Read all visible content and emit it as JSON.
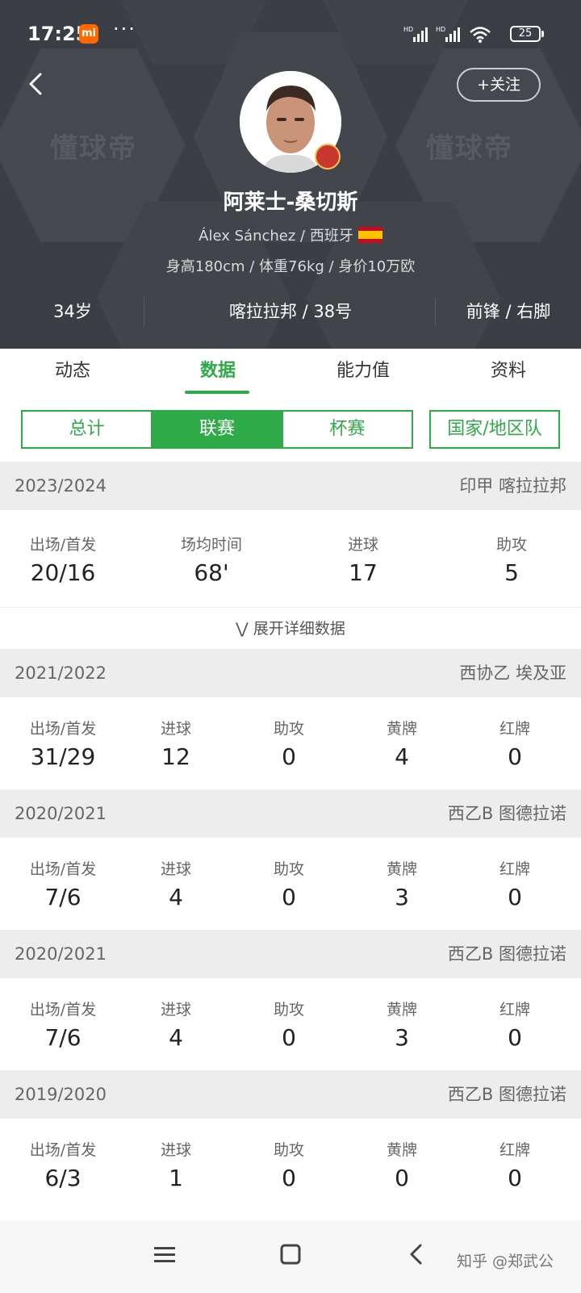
{
  "status_bar": {
    "time": "17:25",
    "mi_label": "mi",
    "dots": "···",
    "battery": "25"
  },
  "header": {
    "follow": "+关注",
    "watermark": "懂球帝",
    "name": "阿莱士-桑切斯",
    "sub_name": "Álex Sánchez / 西班牙",
    "body": "身高180cm / 体重76kg / 身价10万欧",
    "age": "34岁",
    "club_number": "喀拉拉邦 / 38号",
    "position_foot": "前锋 / 右脚"
  },
  "tabs": [
    {
      "label": "动态"
    },
    {
      "label": "数据"
    },
    {
      "label": "能力值"
    },
    {
      "label": "资料"
    }
  ],
  "filters": {
    "total": "总计",
    "league": "联赛",
    "cup": "杯赛",
    "national": "国家/地区队"
  },
  "expand_label": "展开详细数据",
  "seasons": [
    {
      "year": "2023/2024",
      "league": "印甲 喀拉拉邦",
      "stats": [
        {
          "label": "出场/首发",
          "value": "20/16"
        },
        {
          "label": "场均时间",
          "value": "68'"
        },
        {
          "label": "进球",
          "value": "17"
        },
        {
          "label": "助攻",
          "value": "5"
        }
      ]
    },
    {
      "year": "2021/2022",
      "league": "西协乙 埃及亚",
      "stats": [
        {
          "label": "出场/首发",
          "value": "31/29"
        },
        {
          "label": "进球",
          "value": "12"
        },
        {
          "label": "助攻",
          "value": "0"
        },
        {
          "label": "黄牌",
          "value": "4"
        },
        {
          "label": "红牌",
          "value": "0"
        }
      ]
    },
    {
      "year": "2020/2021",
      "league": "西乙B 图德拉诺",
      "stats": [
        {
          "label": "出场/首发",
          "value": "7/6"
        },
        {
          "label": "进球",
          "value": "4"
        },
        {
          "label": "助攻",
          "value": "0"
        },
        {
          "label": "黄牌",
          "value": "3"
        },
        {
          "label": "红牌",
          "value": "0"
        }
      ]
    },
    {
      "year": "2020/2021",
      "league": "西乙B 图德拉诺",
      "stats": [
        {
          "label": "出场/首发",
          "value": "7/6"
        },
        {
          "label": "进球",
          "value": "4"
        },
        {
          "label": "助攻",
          "value": "0"
        },
        {
          "label": "黄牌",
          "value": "3"
        },
        {
          "label": "红牌",
          "value": "0"
        }
      ]
    },
    {
      "year": "2019/2020",
      "league": "西乙B 图德拉诺",
      "stats": [
        {
          "label": "出场/首发",
          "value": "6/3"
        },
        {
          "label": "进球",
          "value": "1"
        },
        {
          "label": "助攻",
          "value": "0"
        },
        {
          "label": "黄牌",
          "value": "0"
        },
        {
          "label": "红牌",
          "value": "0"
        }
      ]
    }
  ],
  "footer_watermark": "知乎 @郑武公"
}
